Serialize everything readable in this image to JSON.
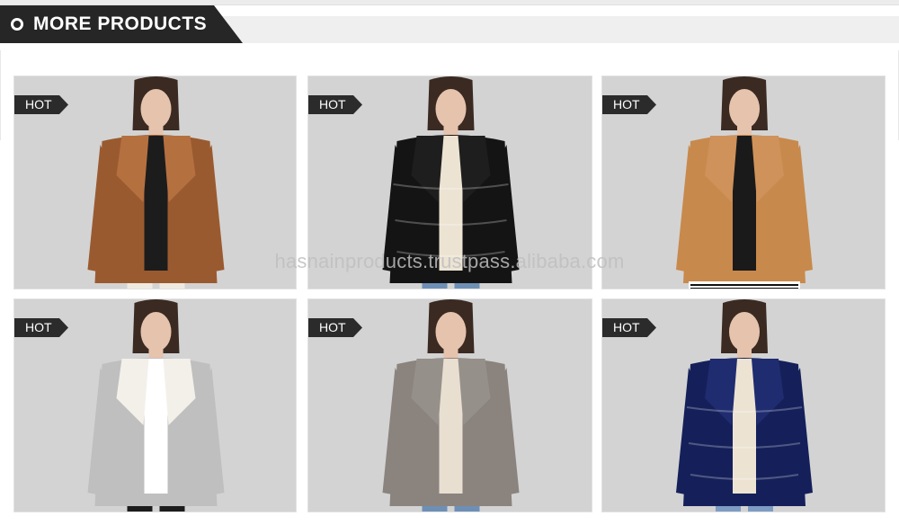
{
  "section": {
    "title": "MORE PRODUCTS",
    "icon": "circle-icon"
  },
  "watermark": "hasnainproducts.trustpass.alibaba.com",
  "badge_color": "#2b2b2b",
  "products": [
    {
      "badge": "HOT",
      "jacket_color": "#9a5a30",
      "collar_color": "#b5703f",
      "inner_color": "#1c1c1c",
      "pants_color": "#efeae0",
      "style": "leather-fur"
    },
    {
      "badge": "HOT",
      "jacket_color": "#141414",
      "collar_color": "#1e1e1e",
      "inner_color": "#ece3d3",
      "pants_color": "#6e8fb5",
      "style": "puffer"
    },
    {
      "badge": "HOT",
      "jacket_color": "#c8894c",
      "collar_color": "#cf925a",
      "inner_color": "#1a1a1a",
      "pants_color": "#1a1a1a",
      "style": "leather"
    },
    {
      "badge": "HOT",
      "jacket_color": "#bfbfbf",
      "collar_color": "#f3f0ea",
      "inner_color": "#ffffff",
      "pants_color": "#1c1c1c",
      "style": "silver-shearling"
    },
    {
      "badge": "HOT",
      "jacket_color": "#8a837e",
      "collar_color": "#96908b",
      "inner_color": "#e8dfd1",
      "pants_color": "#6e8fb5",
      "style": "suede-fur"
    },
    {
      "badge": "HOT",
      "jacket_color": "#15205a",
      "collar_color": "#1f2c70",
      "inner_color": "#ece3d3",
      "pants_color": "#7d9cc3",
      "style": "navy-puffer"
    }
  ]
}
